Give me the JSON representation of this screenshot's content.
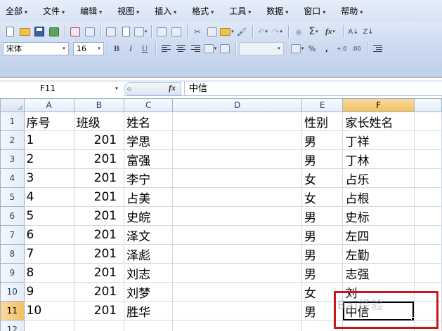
{
  "menu": {
    "items": [
      "全部",
      "文件",
      "编辑",
      "视图",
      "插入",
      "格式",
      "工具",
      "数据",
      "窗口",
      "帮助"
    ]
  },
  "toolbar": {
    "font_name": "宋体",
    "font_size": "16",
    "bold": "B",
    "italic": "I",
    "underline": "U",
    "sum": "Σ",
    "fx": "fx",
    "percent": "%",
    "comma": ","
  },
  "formula_bar": {
    "name_box": "F11",
    "fx_label": "fx",
    "content": "中信"
  },
  "sheet": {
    "columns": [
      "A",
      "B",
      "C",
      "D",
      "E",
      "F"
    ],
    "selected_column": "F",
    "selected_row": "11",
    "rows": [
      {
        "n": "1",
        "a": "序号",
        "b": "班级",
        "c": "姓名",
        "d": "",
        "e": "性别",
        "f": "家长姓名"
      },
      {
        "n": "2",
        "a": "1",
        "b": "201",
        "c": "学思",
        "d": "",
        "e": "男",
        "f": "丁祥"
      },
      {
        "n": "3",
        "a": "2",
        "b": "201",
        "c": "富强",
        "d": "",
        "e": "男",
        "f": "丁林"
      },
      {
        "n": "4",
        "a": "3",
        "b": "201",
        "c": "李宁",
        "d": "",
        "e": "女",
        "f": "占乐"
      },
      {
        "n": "5",
        "a": "4",
        "b": "201",
        "c": "占美",
        "d": "",
        "e": "女",
        "f": "占根"
      },
      {
        "n": "6",
        "a": "5",
        "b": "201",
        "c": "史皖",
        "d": "",
        "e": "男",
        "f": "史标"
      },
      {
        "n": "7",
        "a": "6",
        "b": "201",
        "c": "泽文",
        "d": "",
        "e": "男",
        "f": "左四"
      },
      {
        "n": "8",
        "a": "7",
        "b": "201",
        "c": "泽彪",
        "d": "",
        "e": "男",
        "f": "左勤"
      },
      {
        "n": "9",
        "a": "8",
        "b": "201",
        "c": "刘志",
        "d": "",
        "e": "男",
        "f": "志强"
      },
      {
        "n": "10",
        "a": "9",
        "b": "201",
        "c": "刘梦",
        "d": "",
        "e": "女",
        "f": "刘 "
      },
      {
        "n": "11",
        "a": "10",
        "b": "201",
        "c": "胜华",
        "d": "",
        "e": "男",
        "f": "中信"
      },
      {
        "n": "12",
        "a": "",
        "b": "",
        "c": "",
        "d": "",
        "e": "",
        "f": ""
      }
    ]
  },
  "overlay": {
    "watermark": "Bai经验",
    "highlight_color": "#c8181d"
  }
}
